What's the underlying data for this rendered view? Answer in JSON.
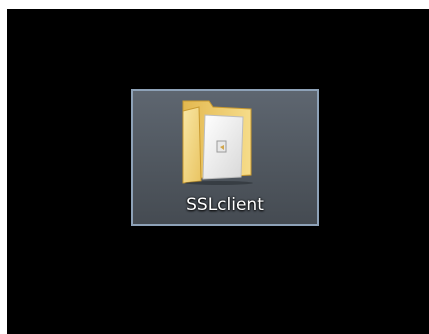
{
  "desktop": {
    "background_color": "#000000",
    "selected_item": {
      "label": "SSLclient",
      "icon": "open-folder-icon",
      "selection_border_color": "#8ea2b8",
      "folder_color": "#f2d27a"
    }
  }
}
